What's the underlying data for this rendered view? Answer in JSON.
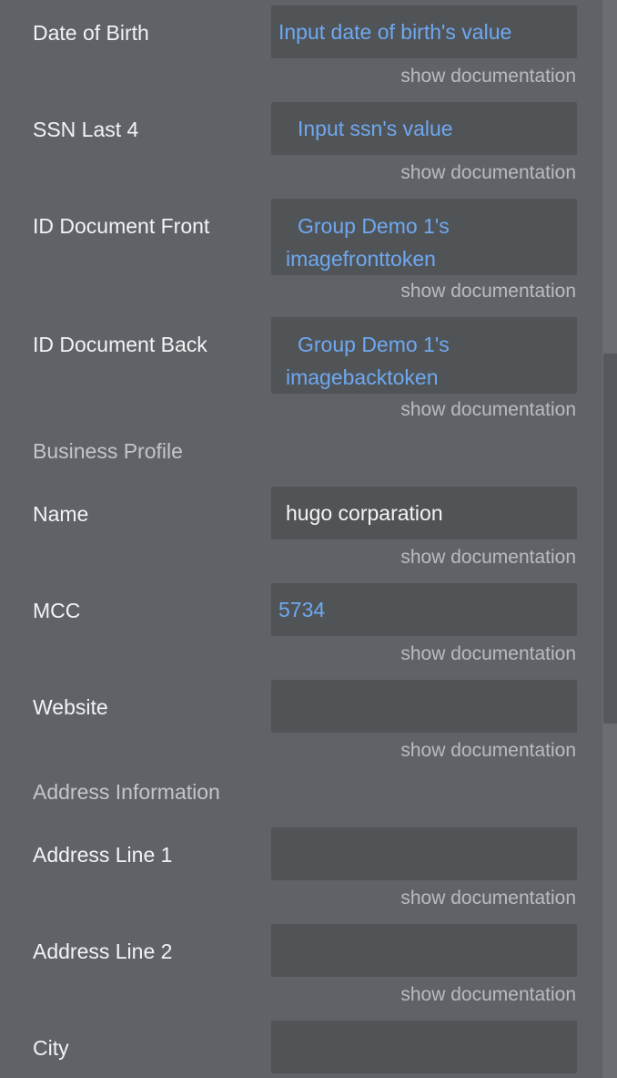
{
  "doc_link": "show documentation",
  "fields": {
    "dob": {
      "label": "Date of Birth",
      "value": "Input date of birth's value"
    },
    "ssn": {
      "label": "SSN Last 4",
      "value": "Input ssn's value"
    },
    "id_front": {
      "label": "ID Document Front",
      "value": "Group Demo 1's imagefronttoken"
    },
    "id_back": {
      "label": "ID Document Back",
      "value": "Group Demo 1's imagebacktoken"
    },
    "name": {
      "label": "Name",
      "value": "hugo corparation"
    },
    "mcc": {
      "label": "MCC",
      "value": "5734"
    },
    "website": {
      "label": "Website",
      "value": ""
    },
    "address1": {
      "label": "Address Line 1",
      "value": ""
    },
    "address2": {
      "label": "Address Line 2",
      "value": ""
    },
    "city": {
      "label": "City",
      "value": ""
    }
  },
  "sections": {
    "business_profile": "Business Profile",
    "address_information": "Address Information"
  }
}
